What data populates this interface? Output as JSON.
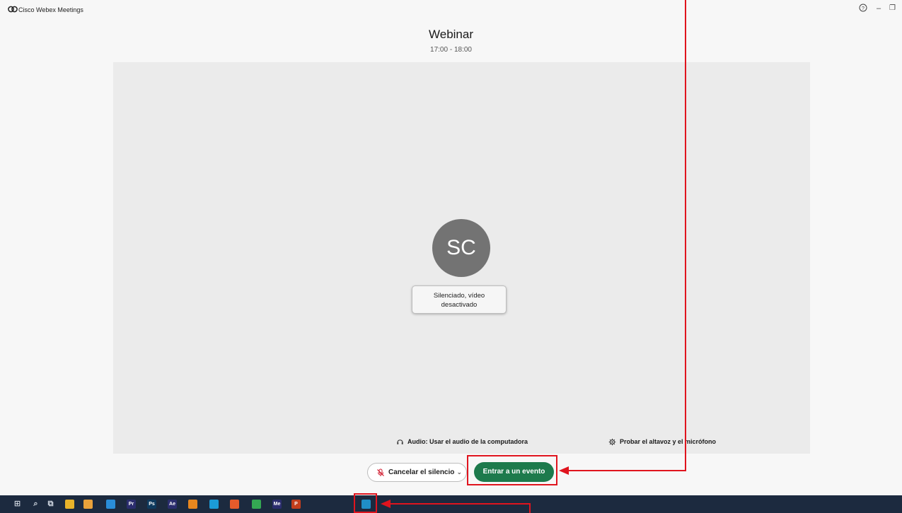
{
  "app": {
    "title": "Cisco Webex Meetings"
  },
  "window_controls": {
    "help": "?",
    "minimize": "–",
    "restore": "❐"
  },
  "meeting": {
    "title": "Webinar",
    "time": "17:00 - 18:00"
  },
  "preview": {
    "avatar_initials": "SC",
    "status_line1": "Silenciado, vídeo",
    "status_line2": "desactivado",
    "audio_option": "Audio: Usar el audio de la computadora",
    "test_option": "Probar el altavoz y el micrófono"
  },
  "controls": {
    "unmute_label": "Cancelar el silencio",
    "join_label": "Entrar a un evento"
  },
  "taskbar": {
    "apps": [
      {
        "name": "windows-start-icon",
        "glyph": "⊞",
        "color": "#1c2a3f"
      },
      {
        "name": "search-icon",
        "glyph": "⌕",
        "color": "#1c2a3f"
      },
      {
        "name": "task-view-icon",
        "glyph": "⧉",
        "color": "#1c2a3f"
      },
      {
        "name": "file-explorer-icon",
        "glyph": "",
        "color": "#e8b32a"
      },
      {
        "name": "chrome-icon",
        "glyph": "",
        "color": "#e9a23b"
      },
      {
        "name": "app-icon",
        "glyph": "",
        "color": "#2a8dd8"
      },
      {
        "name": "premiere-icon",
        "glyph": "Pr",
        "color": "#2b2d6e"
      },
      {
        "name": "photoshop-icon",
        "glyph": "Ps",
        "color": "#0e3a5e"
      },
      {
        "name": "after-effects-icon",
        "glyph": "Ae",
        "color": "#2b2d6e"
      },
      {
        "name": "vlc-icon",
        "glyph": "",
        "color": "#e8871e"
      },
      {
        "name": "edge-icon",
        "glyph": "",
        "color": "#1b9bd7"
      },
      {
        "name": "firefox-icon",
        "glyph": "",
        "color": "#e55b2b"
      },
      {
        "name": "drive-icon",
        "glyph": "",
        "color": "#34a853"
      },
      {
        "name": "media-encoder-icon",
        "glyph": "Me",
        "color": "#2b2d6e"
      },
      {
        "name": "powerpoint-icon",
        "glyph": "P",
        "color": "#c43e1c"
      },
      {
        "name": "webex-icon",
        "glyph": "",
        "color": "#1f8fc8"
      }
    ]
  },
  "colors": {
    "accent": "#1d7a4c",
    "annotation": "#e0141e",
    "taskbar": "#1c2a3f"
  }
}
